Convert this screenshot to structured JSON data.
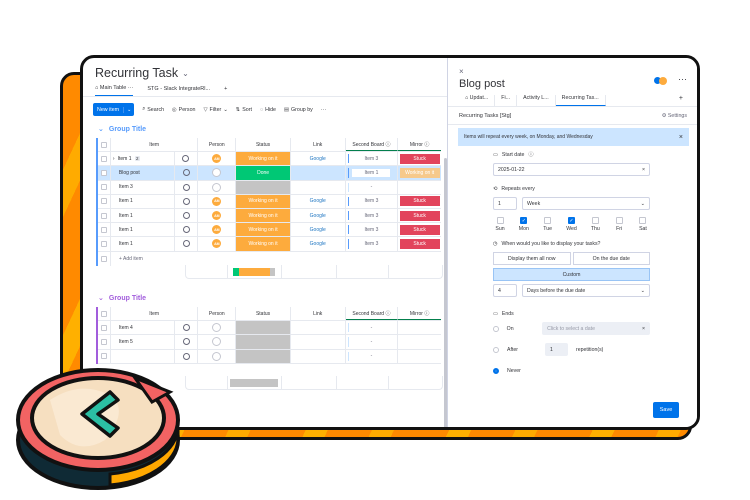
{
  "board": {
    "title": "Recurring Task",
    "view_tabs": [
      "Main Table",
      "STG - Slack IntegrateRl...",
      "+"
    ],
    "view_tab_more": "···",
    "toolbar": {
      "new_item": "New item",
      "search": "Search",
      "person": "Person",
      "filter": "Filter",
      "sort": "Sort",
      "hide": "Hide",
      "group_by": "Group by",
      "more": "···"
    },
    "columns": [
      "Item",
      "Person",
      "Status",
      "Link",
      "Second Board",
      "Mirror"
    ],
    "groups": [
      {
        "title": "Group Title",
        "color": "#579bfc",
        "rows": [
          {
            "item": "Item 1",
            "subitems": "2",
            "person": "AM",
            "status": "Working on it",
            "link": "Google",
            "second_board": "Item 3",
            "mirror": "Stuck"
          },
          {
            "item": "Blog post",
            "subitems": "",
            "person": "",
            "status": "Done",
            "link": "",
            "second_board": "Item 1",
            "mirror": "Working on it",
            "selected": true
          },
          {
            "item": "Item 3",
            "subitems": "",
            "person": "",
            "status": "",
            "link": "",
            "second_board": "-",
            "mirror": ""
          },
          {
            "item": "Item 1",
            "subitems": "",
            "person": "AM",
            "status": "Working on it",
            "link": "Google",
            "second_board": "Item 3",
            "mirror": "Stuck"
          },
          {
            "item": "Item 1",
            "subitems": "",
            "person": "AM",
            "status": "Working on it",
            "link": "Google",
            "second_board": "Item 3",
            "mirror": "Stuck"
          },
          {
            "item": "Item 1",
            "subitems": "",
            "person": "AM",
            "status": "Working on it",
            "link": "Google",
            "second_board": "Item 3",
            "mirror": "Stuck"
          },
          {
            "item": "Item 1",
            "subitems": "",
            "person": "AM",
            "status": "Working on it",
            "link": "Google",
            "second_board": "Item 3",
            "mirror": "Stuck"
          }
        ],
        "add_item": "+ Add item",
        "status_summary": {
          "done": 0.14,
          "working": 0.72,
          "empty": 0.14
        }
      },
      {
        "title": "Group Title",
        "color": "#a25ddc",
        "rows": [
          {
            "item": "Item 4",
            "second_board": "-"
          },
          {
            "item": "Item 5",
            "second_board": "-"
          },
          {
            "item": "",
            "second_board": "-"
          }
        ]
      }
    ]
  },
  "panel": {
    "close": "×",
    "title": "Blog post",
    "more": "···",
    "tabs": [
      "Updat...",
      "Fi...",
      "Activity L...",
      "Recurring Tas...",
      "+"
    ],
    "subtitle": "Recurring Tasks [Stg]",
    "settings": "Settings",
    "banner": "Items will repeat every week, on Monday, and Wednesday",
    "banner_close": "×",
    "start_date_label": "Start date",
    "start_date_value": "2025-01-22",
    "repeats_label": "Repeats every",
    "repeat_count": "1",
    "repeat_unit": "Week",
    "days": [
      {
        "label": "Sun",
        "checked": false
      },
      {
        "label": "Mon",
        "checked": true
      },
      {
        "label": "Tue",
        "checked": false
      },
      {
        "label": "Wed",
        "checked": true
      },
      {
        "label": "Thu",
        "checked": false
      },
      {
        "label": "Fri",
        "checked": false
      },
      {
        "label": "Sat",
        "checked": false
      }
    ],
    "display_label": "When would you like to display your tasks?",
    "display_options": [
      "Display them all now",
      "On the due date",
      "Custom"
    ],
    "display_selected": "Custom",
    "days_before": "4",
    "days_before_unit": "Days before the due date",
    "ends_label": "Ends",
    "end_on": "On",
    "end_on_placeholder": "Click to select a date",
    "end_after": "After",
    "end_after_count": "1",
    "end_after_suffix": "repetition(s)",
    "end_never": "Never",
    "end_selected": "Never",
    "save": "Save"
  },
  "colors": {
    "primary": "#0073ea",
    "working": "#fdab3d",
    "done": "#00c875",
    "stuck": "#e2445c",
    "empty": "#c4c4c4"
  }
}
